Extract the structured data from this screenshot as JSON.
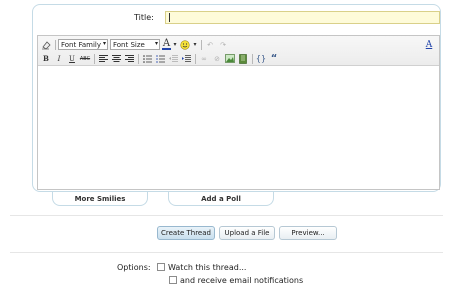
{
  "form": {
    "title_label": "Title:",
    "title_value": ""
  },
  "toolbar": {
    "font_family": "Font Family",
    "font_size": "Font Size",
    "bold": "B",
    "italic": "I",
    "underline": "U",
    "strike": "ABC",
    "text_color": "A",
    "remove_format": "A",
    "quote": "“"
  },
  "tabs": {
    "more_smilies": "More Smilies",
    "add_poll": "Add a Poll"
  },
  "actions": {
    "create_thread": "Create Thread",
    "upload_file": "Upload a File",
    "preview": "Preview..."
  },
  "options": {
    "label": "Options:",
    "watch_thread": "Watch this thread...",
    "email_notify": "and receive email notifications"
  },
  "colors": {
    "accent_border": "#c5dbe6",
    "title_bg": "#fefbd9"
  }
}
